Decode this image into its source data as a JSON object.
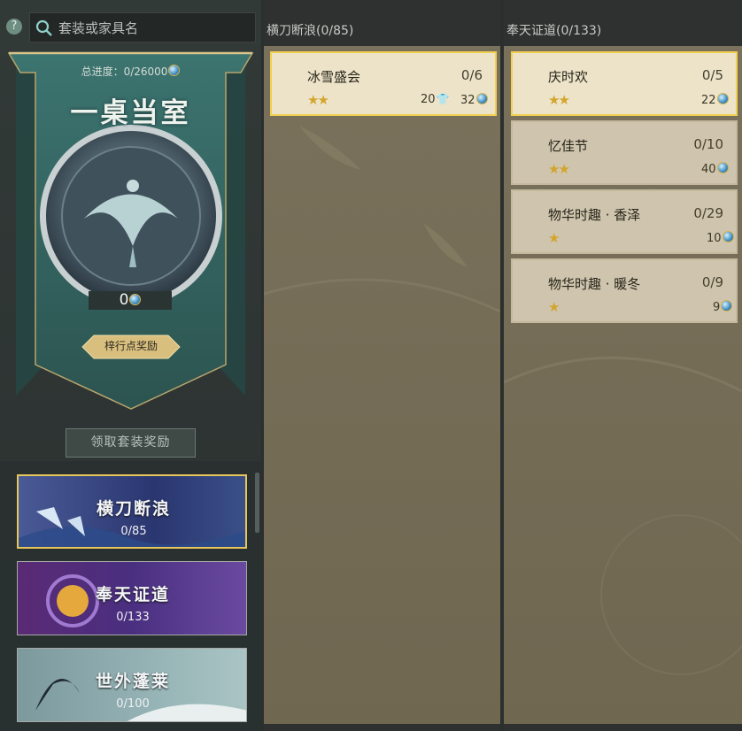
{
  "search": {
    "placeholder": "套装或家具名"
  },
  "help_label": "?",
  "banner": {
    "total_progress": "总进度：0/26000",
    "title": "一桌当室",
    "score": "0",
    "rank_button": "梓行点奖励"
  },
  "claim_button": "领取套装奖励",
  "sets": [
    {
      "name": "横刀断浪",
      "progress": "0/85"
    },
    {
      "name": "奉天证道",
      "progress": "0/133"
    },
    {
      "name": "世外蓬莱",
      "progress": "0/100"
    }
  ],
  "columns": [
    {
      "header": "横刀断浪(0/85)",
      "cards": [
        {
          "name": "冰雪盛会",
          "count": "0/6",
          "stars": "★★",
          "reward_a": "20",
          "reward_b": "32"
        }
      ]
    },
    {
      "header": "奉天证道(0/133)",
      "cards": [
        {
          "name": "庆时欢",
          "count": "0/5",
          "stars": "★★",
          "reward": "22"
        },
        {
          "name": "忆佳节",
          "count": "0/10",
          "stars": "★★",
          "reward": "40"
        },
        {
          "name": "物华时趣 · 香泽",
          "count": "0/29",
          "stars": "★",
          "reward": "10"
        },
        {
          "name": "物华时趣 · 暖冬",
          "count": "0/9",
          "stars": "★",
          "reward": "9"
        }
      ]
    }
  ],
  "colors": {
    "accent_gold": "#e7c65c",
    "teal_banner": "#2f5e5b",
    "card_bg": "#cfc4ad"
  },
  "icons": [
    "search-icon",
    "help-icon",
    "coin-icon",
    "shirt-icon",
    "star-icon",
    "emblem-icon"
  ]
}
